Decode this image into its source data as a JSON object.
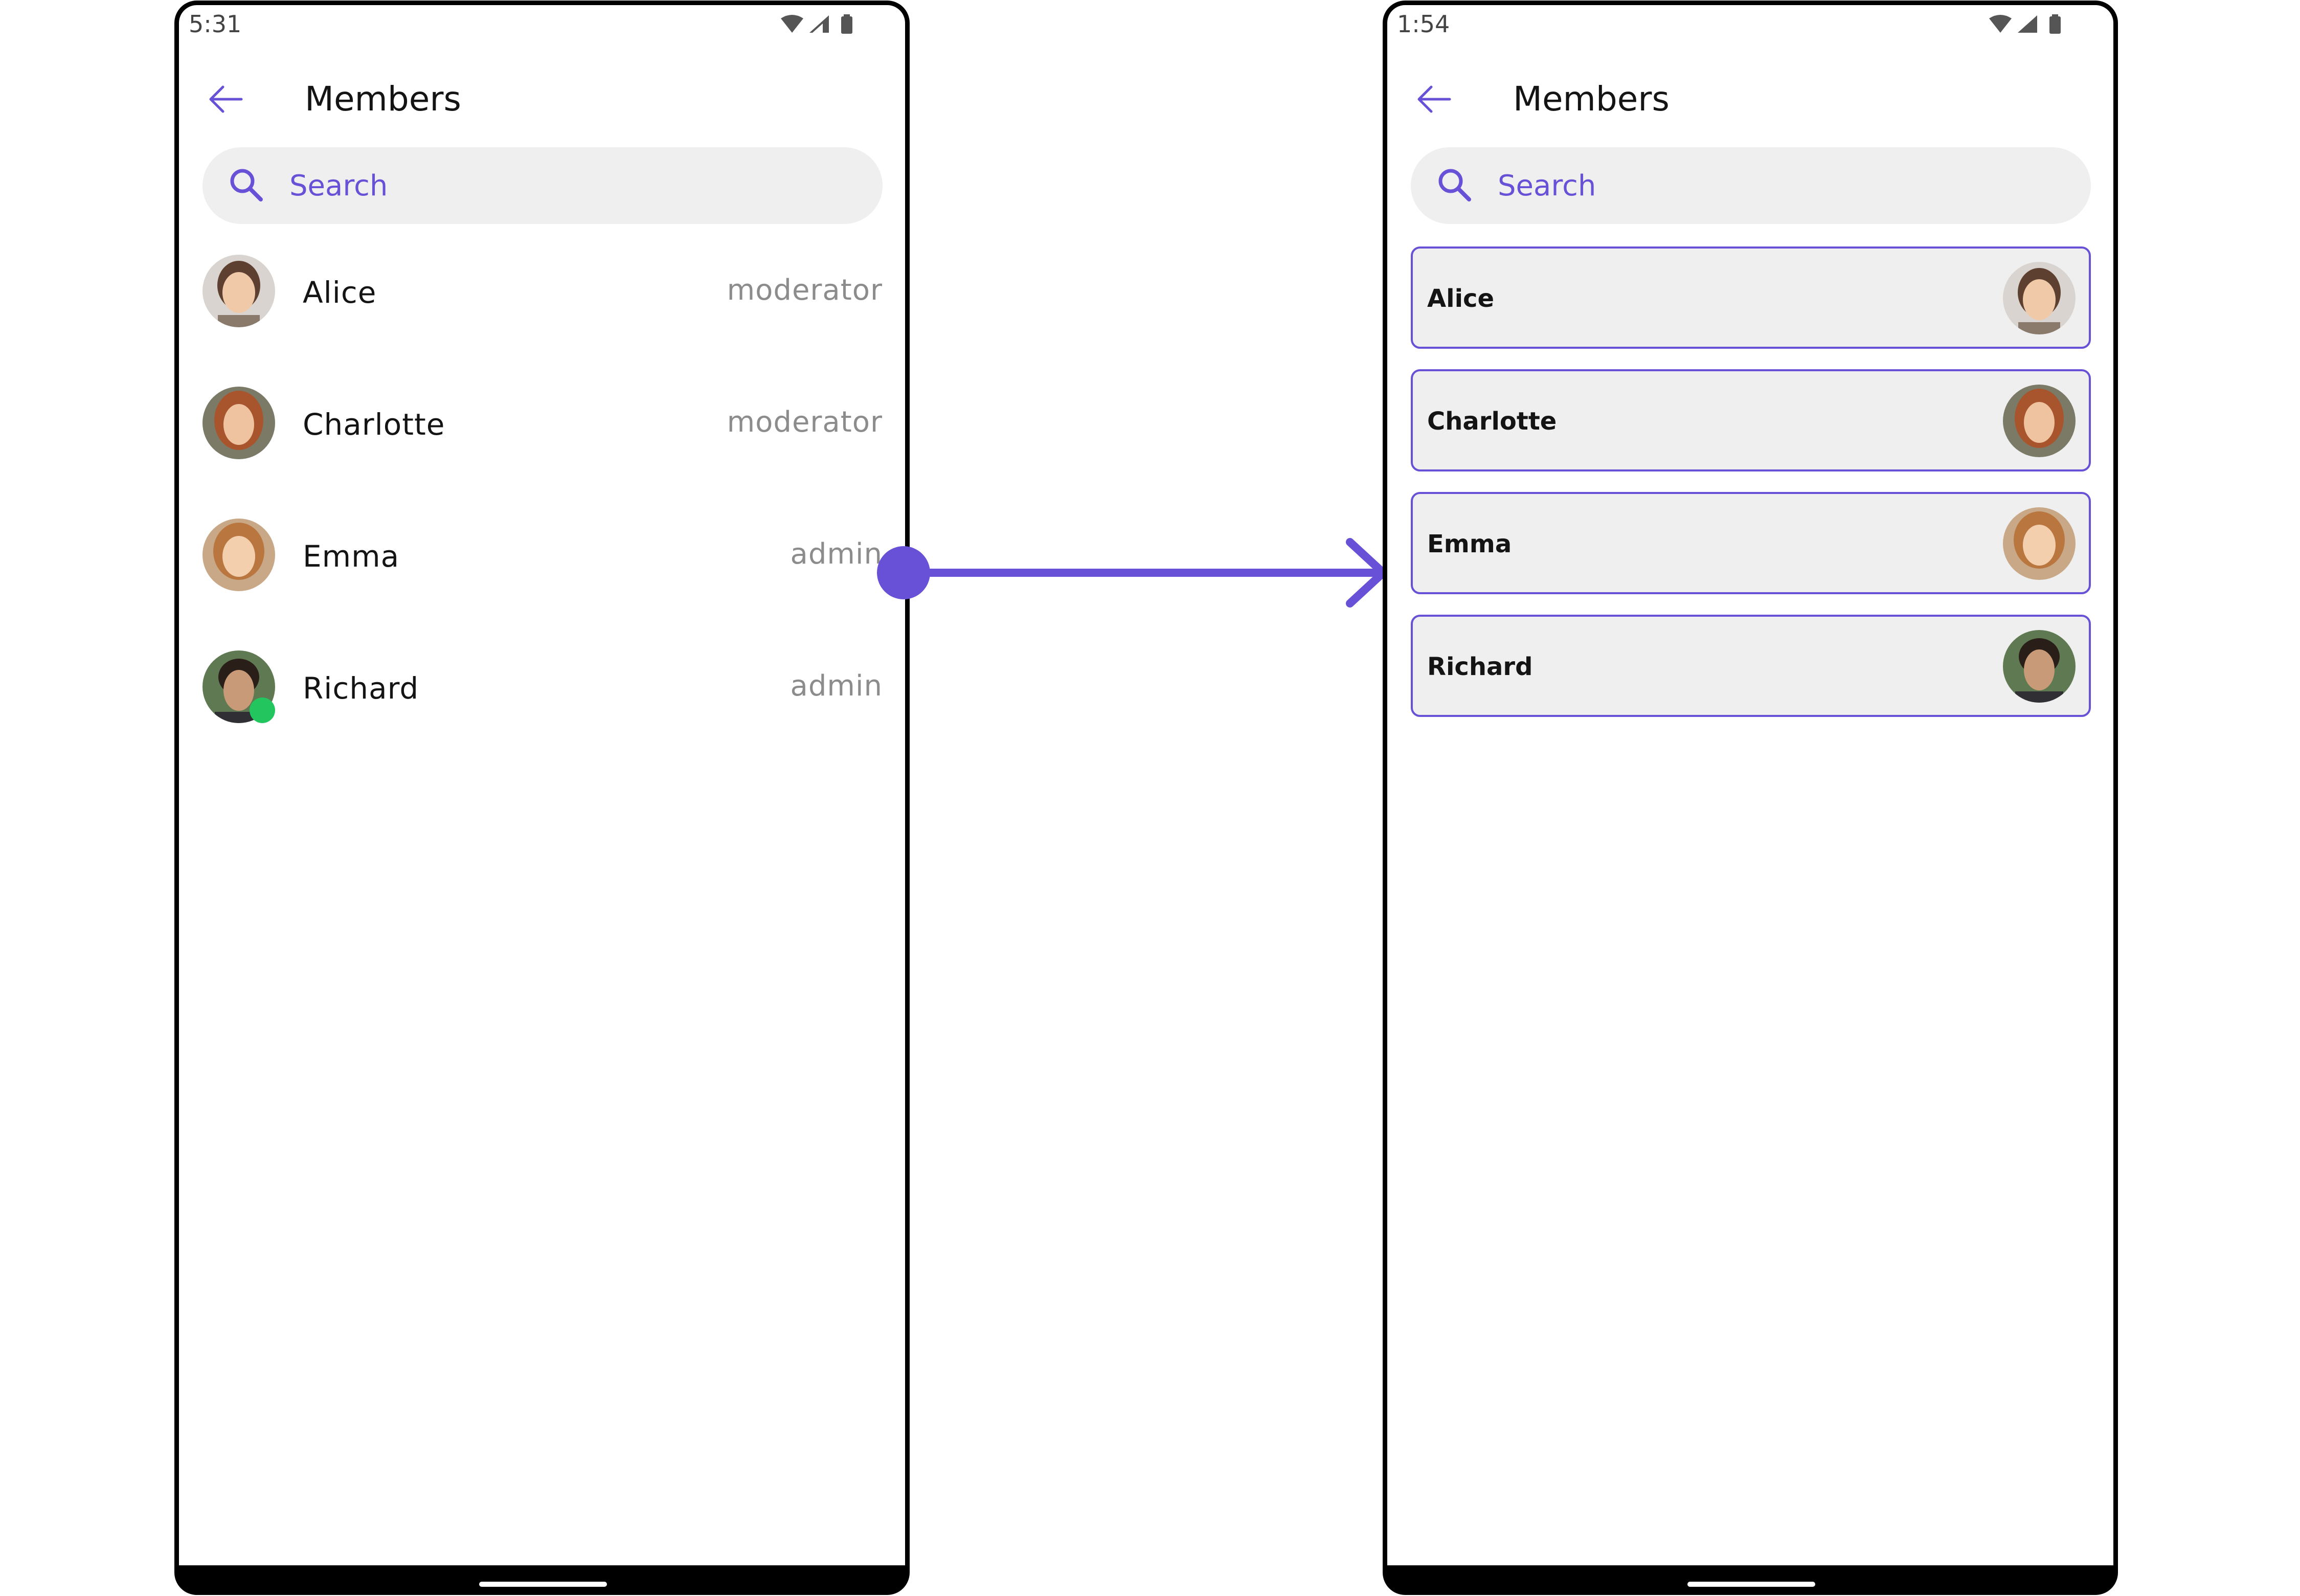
{
  "left_screen": {
    "status_time": "5:31",
    "title": "Members",
    "search_placeholder": "Search",
    "members": [
      {
        "name": "Alice",
        "role": "moderator",
        "online": false
      },
      {
        "name": "Charlotte",
        "role": "moderator",
        "online": false
      },
      {
        "name": "Emma",
        "role": "admin",
        "online": false
      },
      {
        "name": "Richard",
        "role": "admin",
        "online": true
      }
    ]
  },
  "right_screen": {
    "status_time": "1:54",
    "title": "Members",
    "search_placeholder": "Search",
    "members": [
      {
        "name": "Alice"
      },
      {
        "name": "Charlotte"
      },
      {
        "name": "Emma"
      },
      {
        "name": "Richard"
      }
    ]
  },
  "colors": {
    "accent": "#6851d6",
    "search_background": "#efefef",
    "online": "#22c55e",
    "role_text": "#8c8c8c"
  },
  "icons": {
    "back": "arrow-left-icon",
    "search": "search-icon",
    "wifi": "wifi-icon",
    "cell": "cellular-signal-icon",
    "battery": "battery-icon"
  }
}
